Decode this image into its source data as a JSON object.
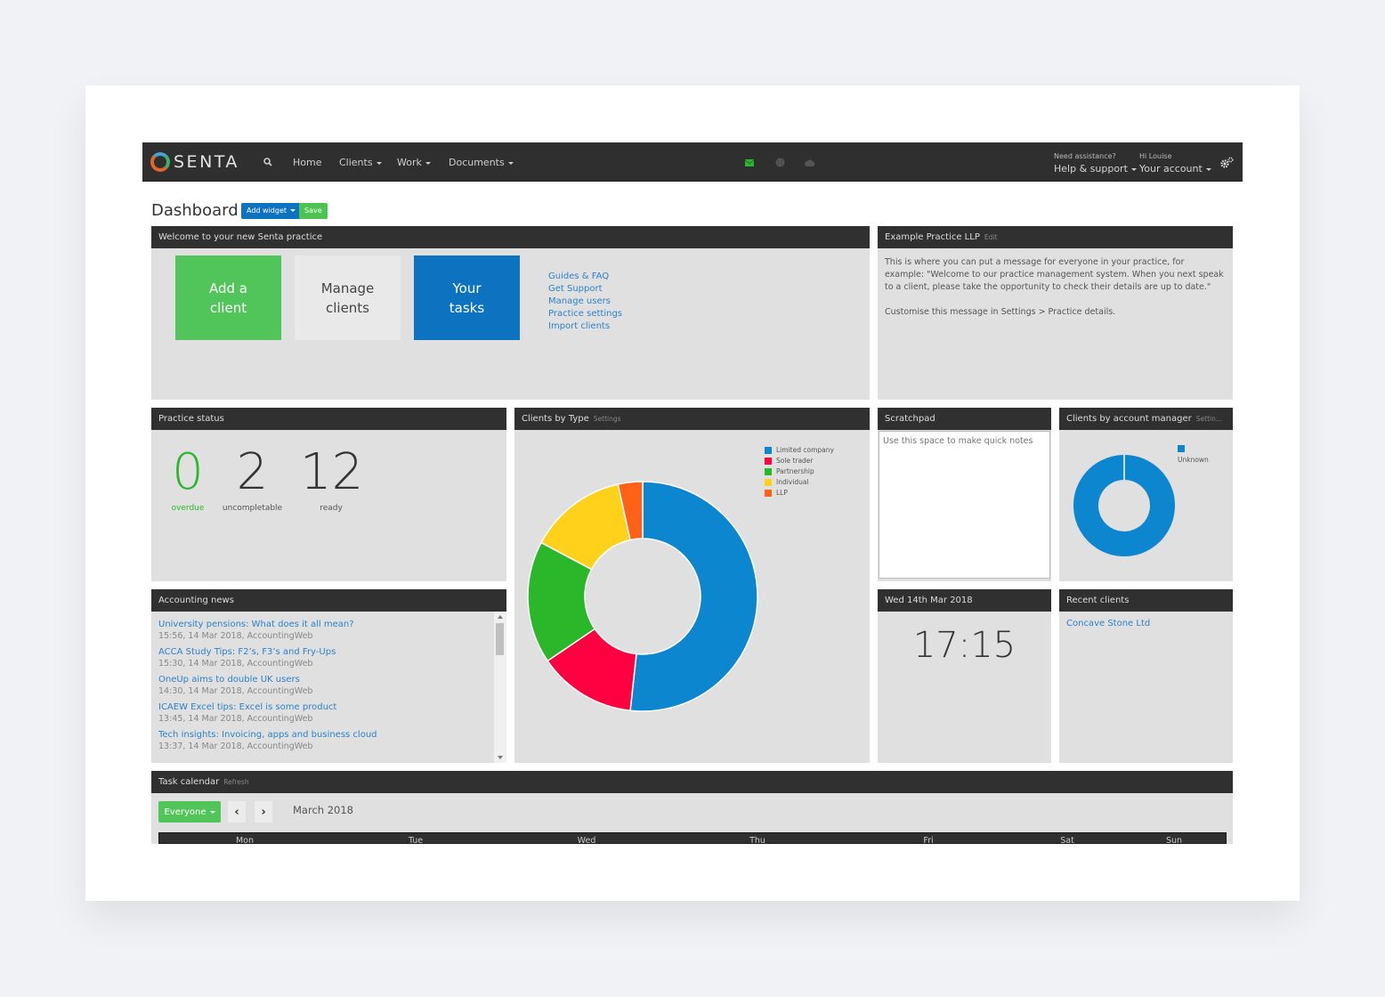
{
  "navbar": {
    "brand": "SENTA",
    "search_icon": "search-icon",
    "items": [
      {
        "label": "Home",
        "dropdown": false
      },
      {
        "label": "Clients",
        "dropdown": true
      },
      {
        "label": "Work",
        "dropdown": true
      },
      {
        "label": "Documents",
        "dropdown": true
      }
    ],
    "status_icons": [
      "envelope-icon",
      "globe-icon",
      "cloud-icon"
    ],
    "help": {
      "small": "Need assistance?",
      "label": "Help & support"
    },
    "account": {
      "small": "Hi Louise",
      "label": "Your account"
    },
    "settings_icon": "gears-icon"
  },
  "header": {
    "title": "Dashboard",
    "add_widget_label": "Add widget",
    "save_label": "Save"
  },
  "welcome": {
    "title": "Welcome to your new Senta practice",
    "tiles": [
      {
        "line1": "Add a",
        "line2": "client"
      },
      {
        "line1": "Manage",
        "line2": "clients"
      },
      {
        "line1": "Your",
        "line2": "tasks"
      }
    ],
    "links": [
      "Guides & FAQ",
      "Get Support",
      "Manage users",
      "Practice settings",
      "Import clients"
    ]
  },
  "practice_message": {
    "title": "Example Practice LLP",
    "edit_label": "Edit",
    "body": "This is where you can put a message for everyone in your practice, for example: \"Welcome to our practice management system.  When you next speak to a client, please take the opportunity to check their details are up to date.\"",
    "footer": "Customise this message in Settings > Practice details."
  },
  "practice_status": {
    "title": "Practice status",
    "stats": [
      {
        "value": "0",
        "label": "overdue",
        "color": "#2db72d"
      },
      {
        "value": "2",
        "label": "uncompletable",
        "color": "#333333"
      },
      {
        "value": "12",
        "label": "ready",
        "color": "#333333"
      }
    ]
  },
  "clients_by_type": {
    "title": "Clients by Type",
    "settings_label": "Settings"
  },
  "scratchpad": {
    "title": "Scratchpad",
    "placeholder": "Use this space to make quick notes",
    "value": ""
  },
  "clients_by_manager": {
    "title": "Clients by account manager",
    "settings_label": "Settin..."
  },
  "news": {
    "title": "Accounting news",
    "items": [
      {
        "title": "University pensions: What does it all mean?",
        "meta": "15:56, 14 Mar 2018, AccountingWeb"
      },
      {
        "title": "ACCA Study Tips: F2’s, F3’s and Fry-Ups",
        "meta": "15:30, 14 Mar 2018, AccountingWeb"
      },
      {
        "title": "OneUp aims to double UK users",
        "meta": "14:30, 14 Mar 2018, AccountingWeb"
      },
      {
        "title": "ICAEW Excel tips: Excel is some product",
        "meta": "13:45, 14 Mar 2018, AccountingWeb"
      },
      {
        "title": "Tech insights: Invoicing, apps and business cloud",
        "meta": "13:37, 14 Mar 2018, AccountingWeb"
      }
    ]
  },
  "clock": {
    "date": "Wed 14th Mar 2018",
    "time": "17:15"
  },
  "recent_clients": {
    "title": "Recent clients",
    "items": [
      "Concave Stone Ltd"
    ]
  },
  "task_calendar": {
    "title": "Task calendar",
    "refresh_label": "Refresh",
    "filter_label": "Everyone",
    "prev_icon": "chevron-left-icon",
    "next_icon": "chevron-right-icon",
    "month": "March 2018",
    "days": [
      "Mon",
      "Tue",
      "Wed",
      "Thu",
      "Fri",
      "Sat",
      "Sun"
    ]
  },
  "chart_data": [
    {
      "type": "pie",
      "title": "Clients by Type",
      "donut": true,
      "categories": [
        "Limited company",
        "Sole trader",
        "Partnership",
        "Individual",
        "LLP"
      ],
      "values": [
        15,
        4,
        5,
        4,
        1
      ],
      "colors": [
        "#0d86d0",
        "#ff0040",
        "#2ab72a",
        "#ffd11a",
        "#ff6116"
      ],
      "slice_order": [
        "Limited company",
        "Sole trader",
        "Partnership",
        "Individual",
        "LLP"
      ],
      "legend": "top-right"
    },
    {
      "type": "pie",
      "title": "Clients by account manager",
      "donut": true,
      "categories": [
        "Unknown"
      ],
      "values": [
        1
      ],
      "colors": [
        "#0d86d0"
      ],
      "legend": "top-right"
    }
  ]
}
